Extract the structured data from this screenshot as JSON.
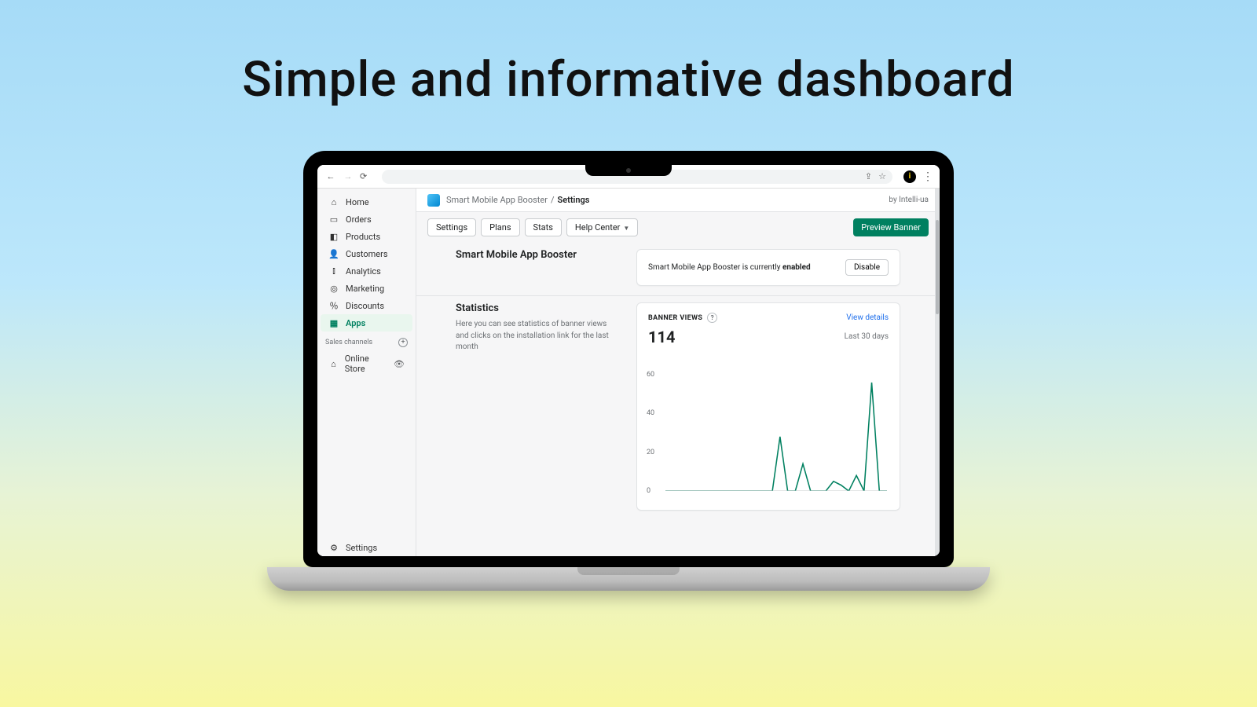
{
  "headline": "Simple and informative dashboard",
  "breadcrumb": {
    "app": "Smart Mobile App Booster",
    "sep": "/",
    "page": "Settings",
    "by": "by Intelli-ua"
  },
  "tabs": {
    "settings": "Settings",
    "plans": "Plans",
    "stats": "Stats",
    "help": "Help Center"
  },
  "buttons": {
    "preview": "Preview Banner",
    "disable": "Disable"
  },
  "sidebar": {
    "items": [
      {
        "label": "Home",
        "icon": "⌂"
      },
      {
        "label": "Orders",
        "icon": "▭"
      },
      {
        "label": "Products",
        "icon": "◧"
      },
      {
        "label": "Customers",
        "icon": "👤"
      },
      {
        "label": "Analytics",
        "icon": "⫾"
      },
      {
        "label": "Marketing",
        "icon": "◎"
      },
      {
        "label": "Discounts",
        "icon": "％"
      },
      {
        "label": "Apps",
        "icon": "▦"
      }
    ],
    "channels_head": "Sales channels",
    "online_store": "Online Store",
    "settings": "Settings"
  },
  "section1": {
    "title": "Smart Mobile App Booster",
    "status_prefix": "Smart Mobile App Booster is currently ",
    "status_state": "enabled"
  },
  "section2": {
    "title": "Statistics",
    "desc": "Here you can see statistics of banner views and clicks on the installation link for the last month",
    "metric_label": "BANNER VIEWS",
    "metric_value": "114",
    "view_details": "View details",
    "period": "Last 30 days"
  },
  "chart_data": {
    "type": "line",
    "title": "Banner views",
    "xlabel": "",
    "ylabel": "",
    "ylim": [
      0,
      60
    ],
    "y_ticks": [
      0,
      20,
      40,
      60
    ],
    "x": [
      0,
      1,
      2,
      3,
      4,
      5,
      6,
      7,
      8,
      9,
      10,
      11,
      12,
      13,
      14,
      15,
      16,
      17,
      18,
      19,
      20,
      21,
      22,
      23,
      24,
      25,
      26,
      27,
      28,
      29
    ],
    "values": [
      0,
      0,
      0,
      0,
      0,
      0,
      0,
      0,
      0,
      0,
      0,
      0,
      0,
      0,
      0,
      28,
      0,
      0,
      14,
      0,
      0,
      0,
      5,
      3,
      0,
      8,
      0,
      56,
      0,
      0
    ]
  }
}
